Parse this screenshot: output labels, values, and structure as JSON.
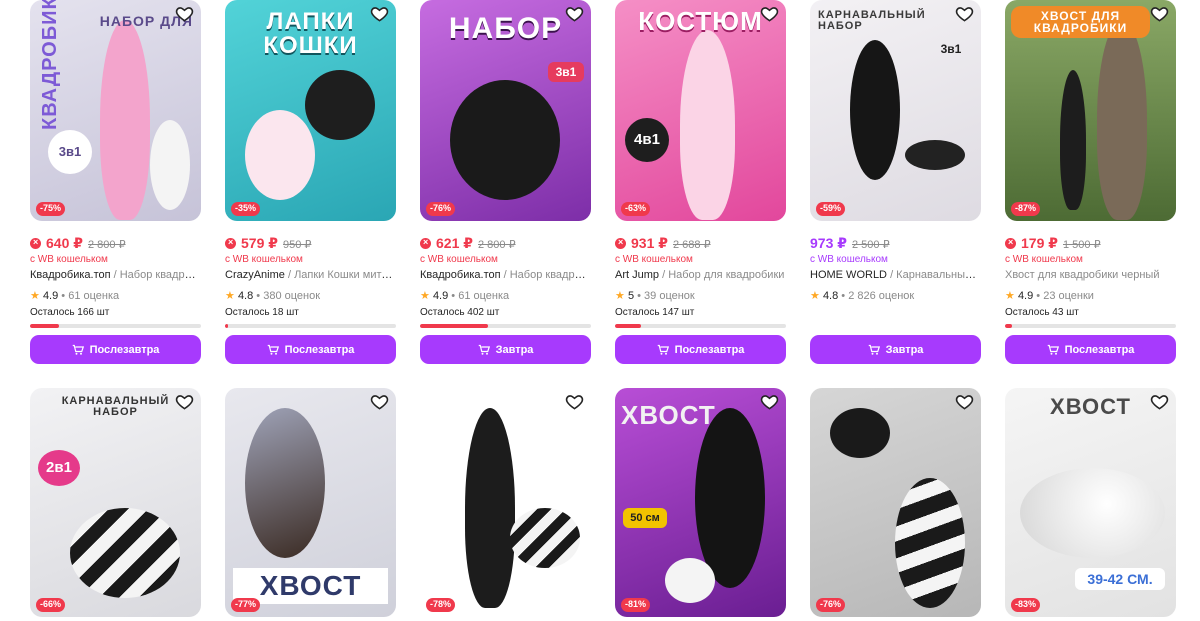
{
  "products": [
    {
      "image": {
        "big": "набор для",
        "side": "квадробики",
        "badge": "3в1",
        "bg": "#d9d6e6"
      },
      "discount": "-75%",
      "price": "640 ₽",
      "old_price": "2 800 ₽",
      "wallet": "с WB кошельком",
      "brand": "Квадробика.топ",
      "category": "/ Набор квадробика",
      "rating": "4.9",
      "reviews": "• 61 оценка",
      "stock": "Осталось 166 шт",
      "stock_fraction": 0.17,
      "button": "Послезавтра"
    },
    {
      "image": {
        "big": "лапки кошки",
        "side": "",
        "badge": "",
        "bg": "#3fc0c9"
      },
      "discount": "-35%",
      "price": "579 ₽",
      "old_price": "950 ₽",
      "wallet": "с WB кошельком",
      "brand": "CrazyAnime",
      "category": "/ Лапки Кошки митенки",
      "rating": "4.8",
      "reviews": "• 380 оценок",
      "stock": "Осталось 18 шт",
      "stock_fraction": 0.02,
      "button": "Послезавтра"
    },
    {
      "image": {
        "big": "набор",
        "side": "",
        "badge": "3в1",
        "bg": "#a84ec4"
      },
      "discount": "-76%",
      "price": "621 ₽",
      "old_price": "2 800 ₽",
      "wallet": "с WB кошельком",
      "brand": "Квадробика.топ",
      "category": "/ Набор квадробика",
      "rating": "4.9",
      "reviews": "• 61 оценка",
      "stock": "Осталось 402 шт",
      "stock_fraction": 0.4,
      "button": "Завтра"
    },
    {
      "image": {
        "big": "костюм",
        "side": "",
        "badge": "4в1",
        "bg": "#f06bb5"
      },
      "discount": "-63%",
      "price": "931 ₽",
      "old_price": "2 688 ₽",
      "wallet": "с WB кошельком",
      "brand": "Art Jump",
      "category": "/ Набор для квадробики",
      "rating": "5",
      "reviews": "• 39 оценок",
      "stock": "Осталось 147 шт",
      "stock_fraction": 0.15,
      "button": "Послезавтра"
    },
    {
      "image": {
        "big": "карнавальный набор",
        "side": "",
        "badge": "3в1",
        "bg": "#ece9ee"
      },
      "discount": "-59%",
      "price": "973 ₽",
      "old_price": "2 500 ₽",
      "wallet": "с WB кошельком",
      "brand": "HOME WORLD",
      "category": "/ Карнавальный набор",
      "rating": "4.8",
      "reviews": "• 2 826 оценок",
      "stock": "",
      "stock_fraction": null,
      "button": "Завтра"
    },
    {
      "image": {
        "big": "хвост для квадробики",
        "side": "",
        "badge": "",
        "bg": "#6e8b4a"
      },
      "discount": "-87%",
      "price": "179 ₽",
      "old_price": "1 500 ₽",
      "wallet": "с WB кошельком",
      "brand": "Хвост для квадробики черный",
      "category": "",
      "rating": "4.9",
      "reviews": "• 23 оценки",
      "stock": "Осталось 43 шт",
      "stock_fraction": 0.04,
      "button": "Послезавтра"
    },
    {
      "image": {
        "big": "карнавальный набор",
        "side": "",
        "badge": "2в1",
        "bg": "#e7e7ea"
      },
      "discount": "-66%"
    },
    {
      "image": {
        "big": "хвост",
        "side": "",
        "badge": "",
        "bg": "#dfe0e6"
      },
      "discount": "-77%"
    },
    {
      "image": {
        "big": "",
        "side": "",
        "badge": "",
        "bg": "#ffffff"
      },
      "discount": "-78%"
    },
    {
      "image": {
        "big": "хвост",
        "side": "",
        "badge": "50 см",
        "bg": "#9b2fbd"
      },
      "discount": "-81%"
    },
    {
      "image": {
        "big": "",
        "side": "",
        "badge": "",
        "bg": "#c9c9c9"
      },
      "discount": "-76%"
    },
    {
      "image": {
        "big": "хвост",
        "side": "",
        "badge": "39-42 СМ.",
        "bg": "#ececec"
      },
      "discount": "-83%"
    }
  ],
  "colors": {
    "accent": "#a73afd",
    "sale": "#f0394c",
    "star": "#ffa825"
  },
  "icons": {
    "favorite": "heart-icon",
    "cart": "cart-icon",
    "wallet": "wallet-discount-icon",
    "rating": "star-icon"
  }
}
